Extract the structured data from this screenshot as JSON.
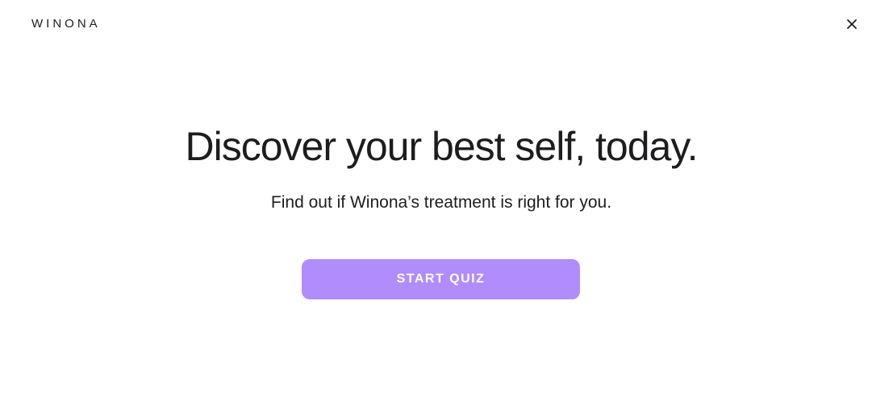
{
  "header": {
    "logo_text": "WINONA",
    "close_icon": "close-icon"
  },
  "main": {
    "headline": "Discover your best self, today.",
    "subtitle": "Find out if Winona’s treatment is right for you.",
    "cta_label": "START QUIZ"
  },
  "colors": {
    "cta_background": "#b18cfc",
    "cta_text": "#ffffff",
    "text": "#1d1d1f",
    "background": "#ffffff"
  }
}
